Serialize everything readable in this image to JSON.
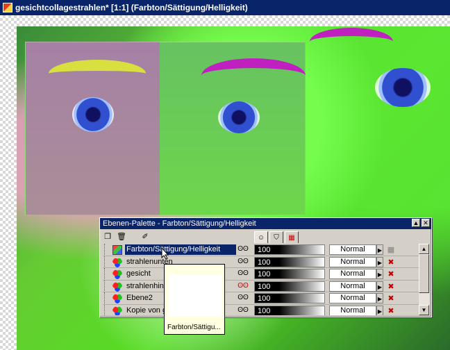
{
  "window": {
    "title": "gesichtcollagestrahlen* [1:1] (Farbton/Sättigung/Helligkeit)"
  },
  "palette": {
    "title": "Ebenen-Palette - Farbton/Sättigung/Helligkeit",
    "controls": [
      "▲",
      "✕"
    ],
    "tabs": [
      "layers-tab",
      "mask-tab",
      "channels-tab"
    ],
    "layers": [
      {
        "name": "Farbton/Sättigung/Helligkeit",
        "icon": "adjustment-icon",
        "visible": true,
        "opacity": "100",
        "blend": "Normal",
        "selected": true
      },
      {
        "name": "strahlenunten",
        "icon": "raster-icon",
        "visible": true,
        "opacity": "100",
        "blend": "Normal",
        "selected": false
      },
      {
        "name": "gesicht",
        "icon": "raster-icon",
        "visible": true,
        "opacity": "100",
        "blend": "Normal",
        "selected": false
      },
      {
        "name": "strahlenhinten",
        "icon": "raster-icon",
        "visible": false,
        "opacity": "100",
        "blend": "Normal",
        "selected": false
      },
      {
        "name": "Ebene2",
        "icon": "raster-icon",
        "visible": true,
        "opacity": "100",
        "blend": "Normal",
        "selected": false
      },
      {
        "name": "Kopie von gesi",
        "icon": "raster-icon",
        "visible": true,
        "opacity": "100",
        "blend": "Normal",
        "selected": false
      }
    ]
  },
  "tooltip": {
    "label": "Farbton/Sättigu..."
  },
  "colors": {
    "titlebar": "#0a246a",
    "dialog": "#d4d0c8",
    "selection": "#0a246a"
  }
}
